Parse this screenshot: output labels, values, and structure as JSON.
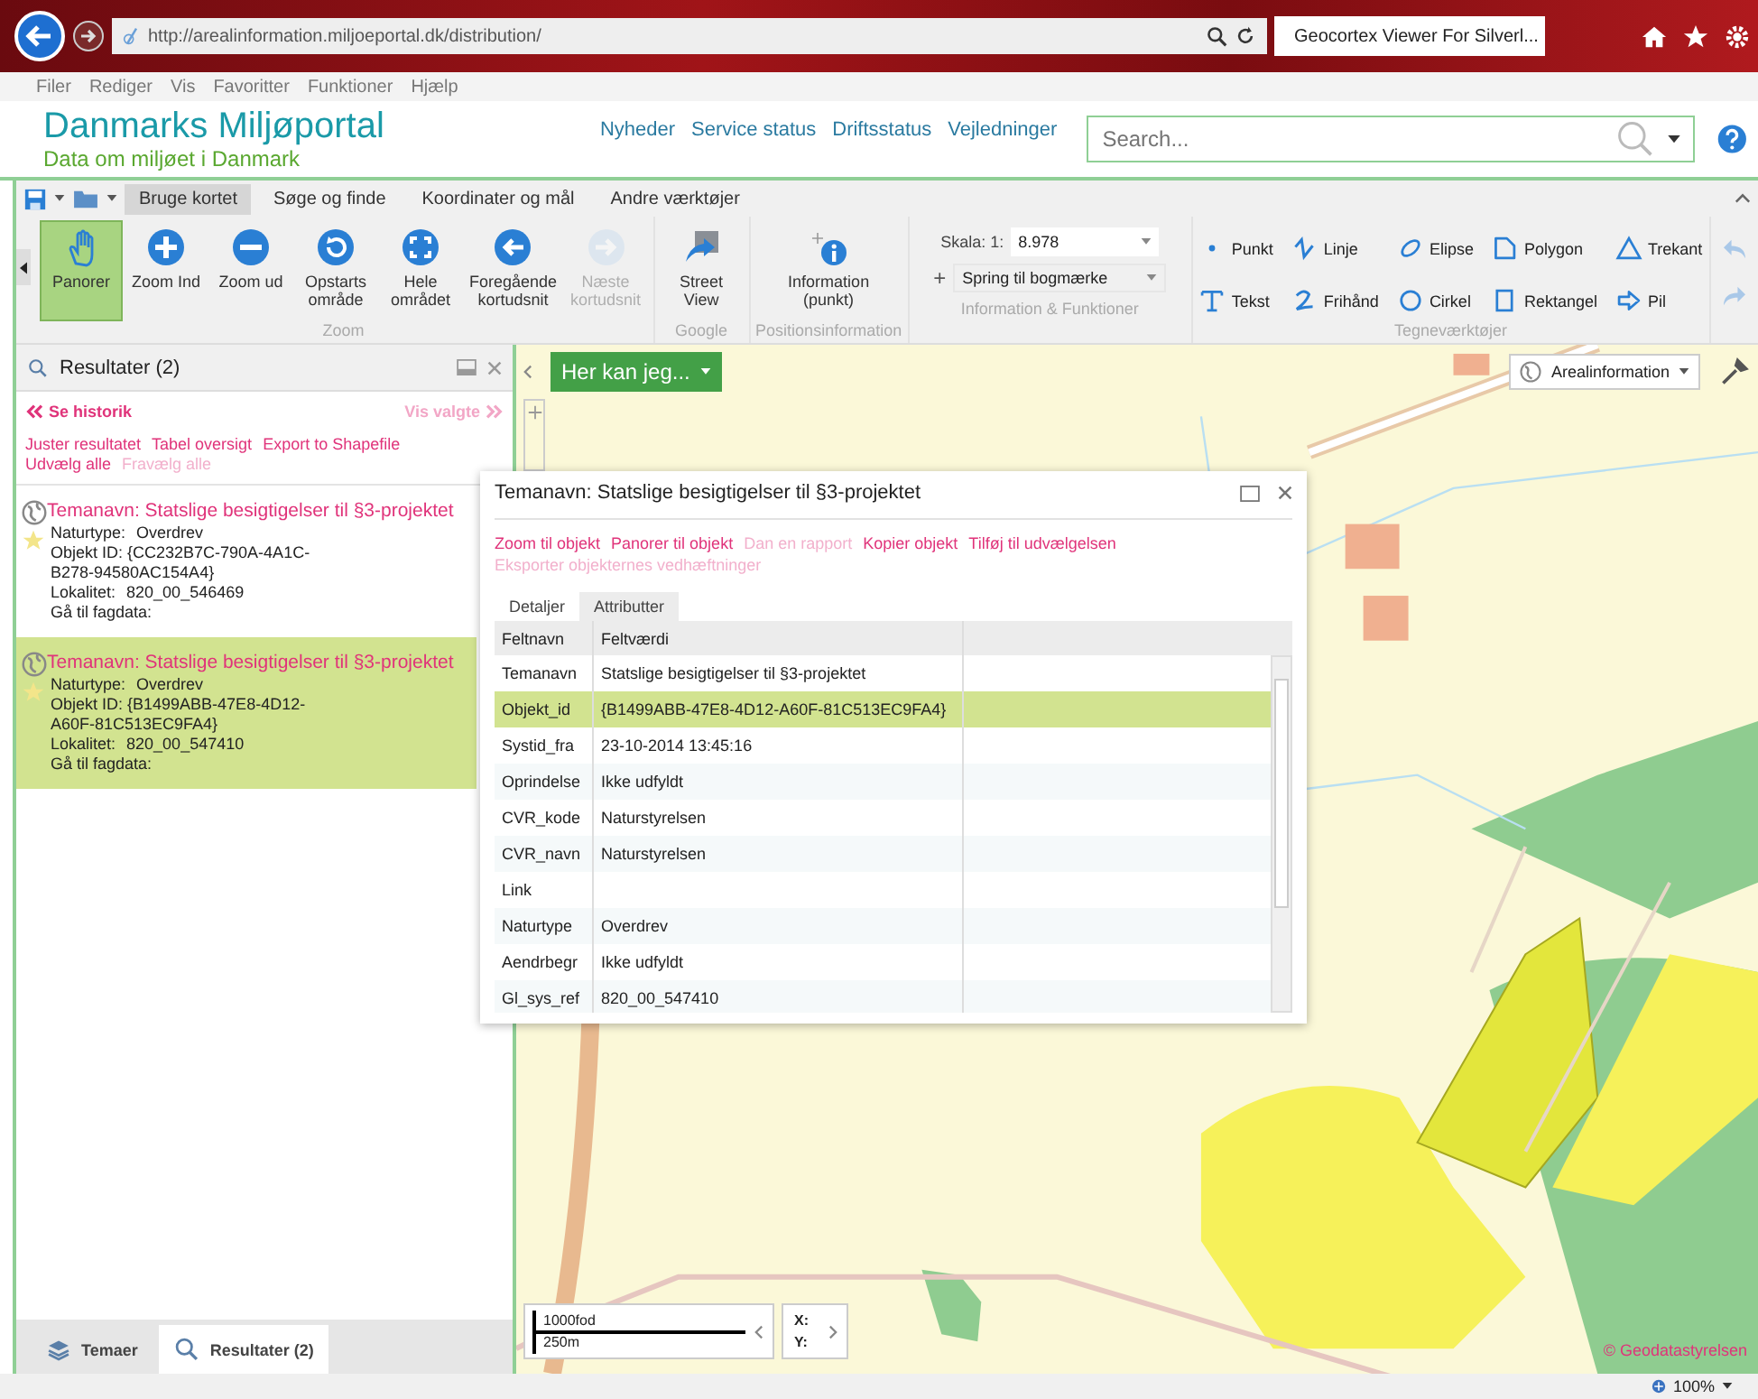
{
  "browser": {
    "url": "http://arealinformation.miljoeportal.dk/distribution/",
    "tab_title": "Geocortex Viewer For Silverl...",
    "menu": [
      "Filer",
      "Rediger",
      "Vis",
      "Favoritter",
      "Funktioner",
      "Hjælp"
    ],
    "zoom": "100%"
  },
  "site": {
    "logo": "Danmarks Miljøportal",
    "tagline": "Data om miljøet i Danmark",
    "nav": [
      "Nyheder",
      "Service status",
      "Driftsstatus",
      "Vejledninger"
    ],
    "search": {
      "placeholder": "Search..."
    }
  },
  "ribbon": {
    "tabs": [
      {
        "label": "Bruge kortet",
        "selected": true
      },
      {
        "label": "Søge og finde",
        "selected": false
      },
      {
        "label": "Koordinater og mål",
        "selected": false
      },
      {
        "label": "Andre værktøjer",
        "selected": false
      }
    ],
    "groups": [
      {
        "label": "Zoom",
        "tools": [
          {
            "label": "Panorer",
            "selected": true,
            "disabled": false
          },
          {
            "label": "Zoom Ind",
            "selected": false,
            "disabled": false
          },
          {
            "label": "Zoom ud",
            "selected": false,
            "disabled": false
          },
          {
            "label": "Opstarts\nområde",
            "selected": false,
            "disabled": false
          },
          {
            "label": "Hele\nområdet",
            "selected": false,
            "disabled": false
          },
          {
            "label": "Foregående\nkortudsnit",
            "selected": false,
            "disabled": false
          },
          {
            "label": "Næste\nkortudsnit",
            "selected": false,
            "disabled": true
          }
        ]
      },
      {
        "label": "Google",
        "tools": [
          {
            "label": "Street\nView",
            "selected": false,
            "disabled": false
          }
        ]
      },
      {
        "label": "Positionsinformation",
        "tools": [
          {
            "label": "Information\n(punkt)",
            "selected": false,
            "disabled": false
          }
        ]
      }
    ],
    "functions": {
      "label": "Information & Funktioner",
      "scale_label": "Skala: 1:",
      "scale_value": "8.978",
      "bookmark_add": "+",
      "bookmark": "Spring til bogmærke"
    },
    "drawing": {
      "label": "Tegneværktøjer",
      "tools": [
        "Punkt",
        "Linje",
        "Elipse",
        "Polygon",
        "Trekant",
        "Tekst",
        "Frihånd",
        "Cirkel",
        "Rektangel",
        "Pil"
      ]
    }
  },
  "results_panel": {
    "title": "Resultater (2)",
    "history": "Se historik",
    "show_selected": "Vis valgte",
    "actions": [
      {
        "label": "Juster resultatet",
        "disabled": false
      },
      {
        "label": "Tabel oversigt",
        "disabled": false
      },
      {
        "label": "Export to Shapefile",
        "disabled": false
      },
      {
        "label": "Udvælg alle",
        "disabled": false
      },
      {
        "label": "Fravælg alle",
        "disabled": true
      }
    ],
    "results": [
      {
        "title": "Temanavn: Statslige besigtigelser til §3-projektet",
        "naturtype_label": "Naturtype:",
        "naturtype": "Overdrev",
        "objekt_id": "Objekt ID: {CC232B7C-790A-4A1C-B278-94580AC154A4}",
        "lokalitet_label": "Lokalitet:",
        "lokalitet": "820_00_546469",
        "link": "Gå til fagdata:",
        "selected": false
      },
      {
        "title": "Temanavn: Statslige besigtigelser til §3-projektet",
        "naturtype_label": "Naturtype:",
        "naturtype": "Overdrev",
        "objekt_id": "Objekt ID: {B1499ABB-47E8-4D12-A60F-81C513EC9FA4}",
        "lokalitet_label": "Lokalitet:",
        "lokalitet": "820_00_547410",
        "link": "Gå til fagdata:",
        "selected": true
      }
    ],
    "bottom_tabs": [
      {
        "label": "Temaer",
        "selected": false
      },
      {
        "label": "Resultater (2)",
        "selected": true
      }
    ]
  },
  "map": {
    "action_button": "Her kan jeg...",
    "layer_menu": "Arealinformation",
    "scale_feet": "1000fod",
    "scale_meters": "250m",
    "x_label": "X:",
    "y_label": "Y:",
    "copyright": "© Geodatastyrelsen"
  },
  "popup": {
    "title": "Temanavn: Statslige besigtigelser til §3-projektet",
    "actions": [
      {
        "label": "Zoom til objekt",
        "disabled": false
      },
      {
        "label": "Panorer til objekt",
        "disabled": false
      },
      {
        "label": "Dan en rapport",
        "disabled": true
      },
      {
        "label": "Kopier objekt",
        "disabled": false
      },
      {
        "label": "Tilføj til udvælgelsen",
        "disabled": false
      },
      {
        "label": "Eksporter objekternes vedhæftninger",
        "disabled": true
      }
    ],
    "tabs": [
      {
        "label": "Detaljer",
        "selected": false
      },
      {
        "label": "Attributter",
        "selected": true
      }
    ],
    "columns": [
      "Feltnavn",
      "Feltværdi"
    ],
    "rows": [
      {
        "name": "Temanavn",
        "value": "Statslige besigtigelser til §3-projektet",
        "selected": false
      },
      {
        "name": "Objekt_id",
        "value": "{B1499ABB-47E8-4D12-A60F-81C513EC9FA4}",
        "selected": true
      },
      {
        "name": "Systid_fra",
        "value": "23-10-2014 13:45:16",
        "selected": false
      },
      {
        "name": "Oprindelse",
        "value": "Ikke udfyldt",
        "selected": false
      },
      {
        "name": "CVR_kode",
        "value": "Naturstyrelsen",
        "selected": false
      },
      {
        "name": "CVR_navn",
        "value": "Naturstyrelsen",
        "selected": false
      },
      {
        "name": "Link",
        "value": "",
        "selected": false
      },
      {
        "name": "Naturtype",
        "value": "Overdrev",
        "selected": false
      },
      {
        "name": "Aendrbegr",
        "value": "Ikke udfyldt",
        "selected": false
      },
      {
        "name": "Gl_sys_ref",
        "value": "820_00_547410",
        "selected": false
      }
    ]
  }
}
